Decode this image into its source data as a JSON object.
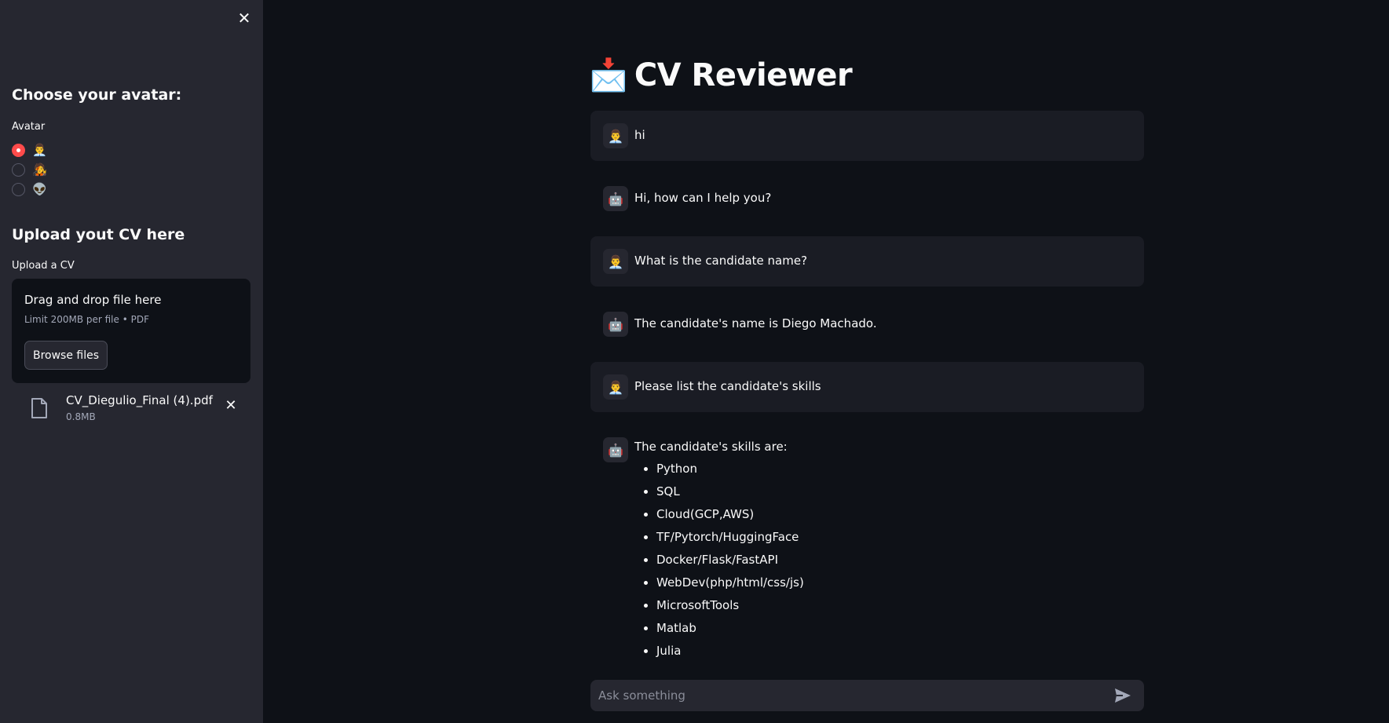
{
  "sidebar": {
    "avatar_heading": "Choose your avatar:",
    "avatar_label": "Avatar",
    "avatar_options": [
      "👨‍💼",
      "🧑‍🎤",
      "👽"
    ],
    "selected_avatar_index": 0,
    "upload_heading": "Upload yout CV here",
    "upload_label": "Upload a CV",
    "dropzone_title": "Drag and drop file here",
    "dropzone_subtitle": "Limit 200MB per file • PDF",
    "browse_label": "Browse files",
    "file": {
      "name": "CV_Diegulio_Final (4).pdf",
      "size": "0.8MB"
    }
  },
  "main": {
    "title_icon": "📩",
    "title": "CV Reviewer",
    "messages": [
      {
        "role": "user",
        "avatar": "👨‍💼",
        "text": "hi"
      },
      {
        "role": "assistant",
        "avatar": "🤖",
        "text": "Hi, how can I help you?"
      },
      {
        "role": "user",
        "avatar": "👨‍💼",
        "text": "What is the candidate name?"
      },
      {
        "role": "assistant",
        "avatar": "🤖",
        "text": "The candidate's name is Diego Machado."
      },
      {
        "role": "user",
        "avatar": "👨‍💼",
        "text": "Please list the candidate's skills"
      },
      {
        "role": "assistant",
        "avatar": "🤖",
        "text": "The candidate's skills are:",
        "skills": [
          "Python",
          "SQL",
          "Cloud(GCP,AWS)",
          "TF/Pytorch/HuggingFace",
          "Docker/Flask/FastAPI",
          "WebDev(php/html/css/js)",
          "MicrosoftTools",
          "Matlab",
          "Julia"
        ]
      }
    ],
    "input_placeholder": "Ask something"
  },
  "colors": {
    "background": "#0e1117",
    "sidebar": "#262730",
    "accent": "#ff4b4b",
    "user_message_bg": "#1a1c24"
  }
}
